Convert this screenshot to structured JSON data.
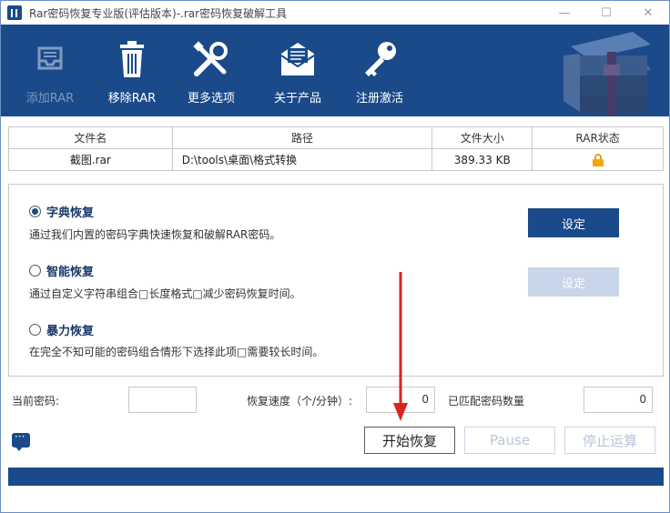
{
  "window": {
    "title": "Rar密码恢复专业版(评估版本)-.rar密码恢复破解工具",
    "controls": [
      "—",
      "☐",
      "✕"
    ]
  },
  "toolbar": {
    "items": [
      {
        "label": "添加RAR",
        "icon": "tray-icon",
        "enabled": false
      },
      {
        "label": "移除RAR",
        "icon": "trash-icon",
        "enabled": true
      },
      {
        "label": "更多选项",
        "icon": "tools-icon",
        "enabled": true
      },
      {
        "label": "关于产品",
        "icon": "envelope-icon",
        "enabled": true
      },
      {
        "label": "注册激活",
        "icon": "key-icon",
        "enabled": true
      }
    ]
  },
  "file_table": {
    "headers": [
      "文件名",
      "路径",
      "文件大小",
      "RAR状态"
    ],
    "rows": [
      {
        "name": "截图.rar",
        "path": "D:\\tools\\桌面\\格式转换",
        "size": "389.33 KB",
        "status_icon": "lock-icon"
      }
    ]
  },
  "modes": [
    {
      "title": "字典恢复",
      "selected": true,
      "desc": "通过我们内置的密码字典快速恢复和破解RAR密码。",
      "button": "设定",
      "button_enabled": true
    },
    {
      "title": "智能恢复",
      "selected": false,
      "desc": "通过自定义字符串组合□长度格式□减少密码恢复时间。",
      "button": "设定",
      "button_enabled": false
    },
    {
      "title": "暴力恢复",
      "selected": false,
      "desc": "在完全不知可能的密码组合情形下选择此项□需要较长时间。"
    }
  ],
  "stats": {
    "current_password_label": "当前密码:",
    "current_password_value": "",
    "speed_label": "恢复速度（个/分钟）:",
    "speed_value": "0",
    "matched_label": "已匹配密码数量",
    "matched_value": "0"
  },
  "actions": {
    "start": "开始恢复",
    "pause": "Pause",
    "stop": "停止运算"
  },
  "colors": {
    "primary": "#1a4a8a",
    "disabled": "#c9d5e8",
    "annotation": "#d9251c",
    "lock": "#f2a900"
  }
}
